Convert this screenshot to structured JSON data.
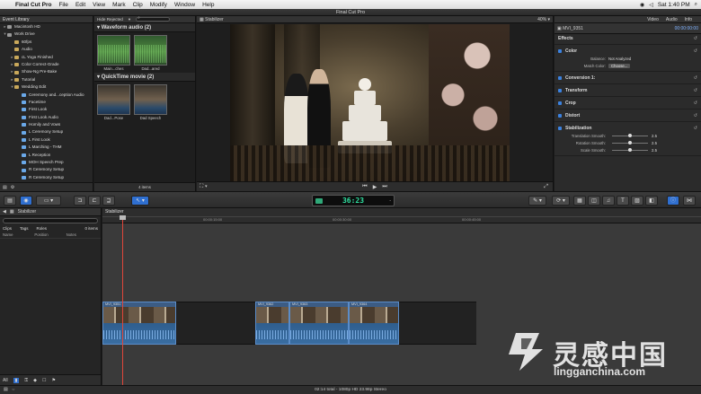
{
  "menubar": {
    "app": "Final Cut Pro",
    "items": [
      "File",
      "Edit",
      "View",
      "Mark",
      "Clip",
      "Modify",
      "Window",
      "Help"
    ],
    "clock": "Sat 1:40 PM"
  },
  "window": {
    "title": "Final Cut Pro"
  },
  "library": {
    "title": "Event Library",
    "items": [
      {
        "label": "Macintosh HD",
        "type": "drive",
        "level": 0,
        "twisty": "▸"
      },
      {
        "label": "Work Drive",
        "type": "drive",
        "level": 0,
        "twisty": "▾"
      },
      {
        "label": "60fps",
        "type": "event",
        "level": 1,
        "twisty": ""
      },
      {
        "label": "Audio",
        "type": "event",
        "level": 1,
        "twisty": ""
      },
      {
        "label": "cL Yoga Finished",
        "type": "event",
        "level": 1,
        "twisty": "▸"
      },
      {
        "label": "Color Correct-Grade",
        "type": "event",
        "level": 1,
        "twisty": "▸"
      },
      {
        "label": "Show-Ng Pre-Bake",
        "type": "event",
        "level": 1,
        "twisty": "▸"
      },
      {
        "label": "Tutorial",
        "type": "event",
        "level": 1,
        "twisty": "▸"
      },
      {
        "label": "Wedding Edit",
        "type": "event",
        "level": 1,
        "twisty": "▾"
      },
      {
        "label": "Ceremony and...ception Audio",
        "type": "clip",
        "level": 2,
        "twisty": ""
      },
      {
        "label": "Facetime",
        "type": "clip",
        "level": 2,
        "twisty": ""
      },
      {
        "label": "First Look",
        "type": "clip",
        "level": 2,
        "twisty": ""
      },
      {
        "label": "First Look Audio",
        "type": "clip",
        "level": 2,
        "twisty": ""
      },
      {
        "label": "Homily and Vows",
        "type": "clip",
        "level": 2,
        "twisty": ""
      },
      {
        "label": "L Ceremony Setup",
        "type": "clip",
        "level": 2,
        "twisty": ""
      },
      {
        "label": "L First Look",
        "type": "clip",
        "level": 2,
        "twisty": ""
      },
      {
        "label": "L Marching - THM",
        "type": "clip",
        "level": 2,
        "twisty": ""
      },
      {
        "label": "L Reception",
        "type": "clip",
        "level": 2,
        "twisty": ""
      },
      {
        "label": "MOH Speech Prep",
        "type": "clip",
        "level": 2,
        "twisty": ""
      },
      {
        "label": "R Ceremony Setup",
        "type": "clip",
        "level": 2,
        "twisty": ""
      },
      {
        "label": "R Ceremony Setup",
        "type": "clip",
        "level": 2,
        "twisty": ""
      }
    ]
  },
  "browser": {
    "filter": "Hide Rejected",
    "search_placeholder": "",
    "groups": [
      {
        "title": "Waveform audio  (2)",
        "clips": [
          {
            "caption": "Main...ches",
            "kind": "wave"
          },
          {
            "caption": "Dad...ared",
            "kind": "wave"
          }
        ]
      },
      {
        "title": "QuickTime movie  (2)",
        "clips": [
          {
            "caption": "Dad...Pose",
            "kind": "movie"
          },
          {
            "caption": "Dad Speech",
            "kind": "movie"
          }
        ]
      }
    ],
    "item_count": "4 items"
  },
  "viewer": {
    "title": "Stabilizer",
    "zoom": "40%"
  },
  "inspector": {
    "tabs": [
      "Video",
      "Audio",
      "Info"
    ],
    "clip_name": "MVI_9351",
    "clip_timecode": "00:00:00:00",
    "sections": [
      {
        "title": "Effects",
        "rows": []
      },
      {
        "title": "Color",
        "rows": [
          {
            "label": "Balance:",
            "value": "Not Analyzed"
          },
          {
            "label": "Match Color:",
            "value": "Choose..."
          }
        ]
      },
      {
        "title": "Conversion 1:",
        "rows": []
      },
      {
        "title": "Transform",
        "rows": []
      },
      {
        "title": "Crop",
        "rows": []
      },
      {
        "title": "Distort",
        "rows": []
      },
      {
        "title": "Stabilization",
        "rows": [
          {
            "label": "Translation Smooth:",
            "value": "2.5"
          },
          {
            "label": "Rotation Smooth:",
            "value": "2.5"
          },
          {
            "label": "Scale Smooth:",
            "value": "2.5"
          }
        ]
      }
    ]
  },
  "toolbar": {
    "timecode": "36:23"
  },
  "timeline_index": {
    "project": "Stabilizer",
    "tabs": [
      "Clips",
      "Tags",
      "Roles"
    ],
    "item_count": "0 items",
    "columns": [
      "Name",
      "Position",
      "Notes"
    ],
    "footer": "All"
  },
  "timeline": {
    "project": "Stabilizer",
    "ticks": [
      "00:00:15:00",
      "00:00:30:00",
      "00:00:45:00"
    ],
    "clips": [
      "MVI_9351",
      "MVI_9362",
      "MVI_9363",
      "MVI_9364"
    ]
  },
  "status": {
    "text": "02:14 total - 1080p HD 23.98p Stereo"
  },
  "watermark": {
    "cn": "灵感中国",
    "url": "lingganchina.com"
  }
}
